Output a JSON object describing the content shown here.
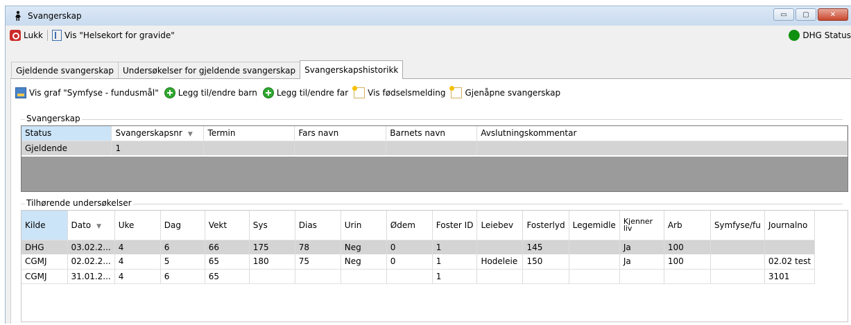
{
  "window": {
    "title": "Svangerskap",
    "buttons": {
      "minimize": "▭",
      "maximize": "▢",
      "close": "✕"
    }
  },
  "toolbar": {
    "close_label": "Lukk",
    "show_card_label": "Vis \"Helsekort for gravide\"",
    "status_label": "DHG Status",
    "status_color": "#109010"
  },
  "tabs": [
    {
      "label": "Gjeldende svangerskap"
    },
    {
      "label": "Undersøkelser for gjeldende svangerskap"
    },
    {
      "label": "Svangerskapshistorikk"
    }
  ],
  "actions": {
    "graph": "Vis graf \"Symfyse - fundusmål\"",
    "add_child": "Legg til/endre barn",
    "add_father": "Legg til/endre far",
    "birth_notice": "Vis fødselsmelding",
    "reopen": "Gjenåpne svangerskap"
  },
  "pregnancy": {
    "group_label": "Svangerskap",
    "columns": [
      "Status",
      "Svangerskapsnr",
      "Termin",
      "Fars navn",
      "Barnets navn",
      "Avslutningskommentar"
    ],
    "rows": [
      [
        "Gjeldende",
        "1",
        "",
        "",
        "",
        ""
      ]
    ]
  },
  "exams": {
    "group_label": "Tilhørende undersøkelser",
    "columns": [
      "Kilde",
      "Dato",
      "Uke",
      "Dag",
      "Vekt",
      "Sys",
      "Dias",
      "Urin",
      "Ødem",
      "Foster ID",
      "Leiebev",
      "Fosterlyd",
      "Legemidle",
      "Kjenner liv",
      "Arb",
      "Symfyse/fu",
      "Journalno"
    ],
    "rows": [
      [
        "DHG",
        "03.02.2...",
        "4",
        "6",
        "66",
        "175",
        "78",
        "Neg",
        "0",
        "1",
        "",
        "145",
        "",
        "Ja",
        "100",
        "",
        ""
      ],
      [
        "CGMJ",
        "02.02.2...",
        "4",
        "5",
        "65",
        "180",
        "75",
        "Neg",
        "0",
        "1",
        "Hodeleie",
        "150",
        "",
        "Ja",
        "100",
        "",
        "02.02 test"
      ],
      [
        "CGMJ",
        "31.01.2...",
        "4",
        "6",
        "65",
        "",
        "",
        "",
        "",
        "1",
        "",
        "",
        "",
        "",
        "",
        "",
        "3101"
      ]
    ]
  }
}
